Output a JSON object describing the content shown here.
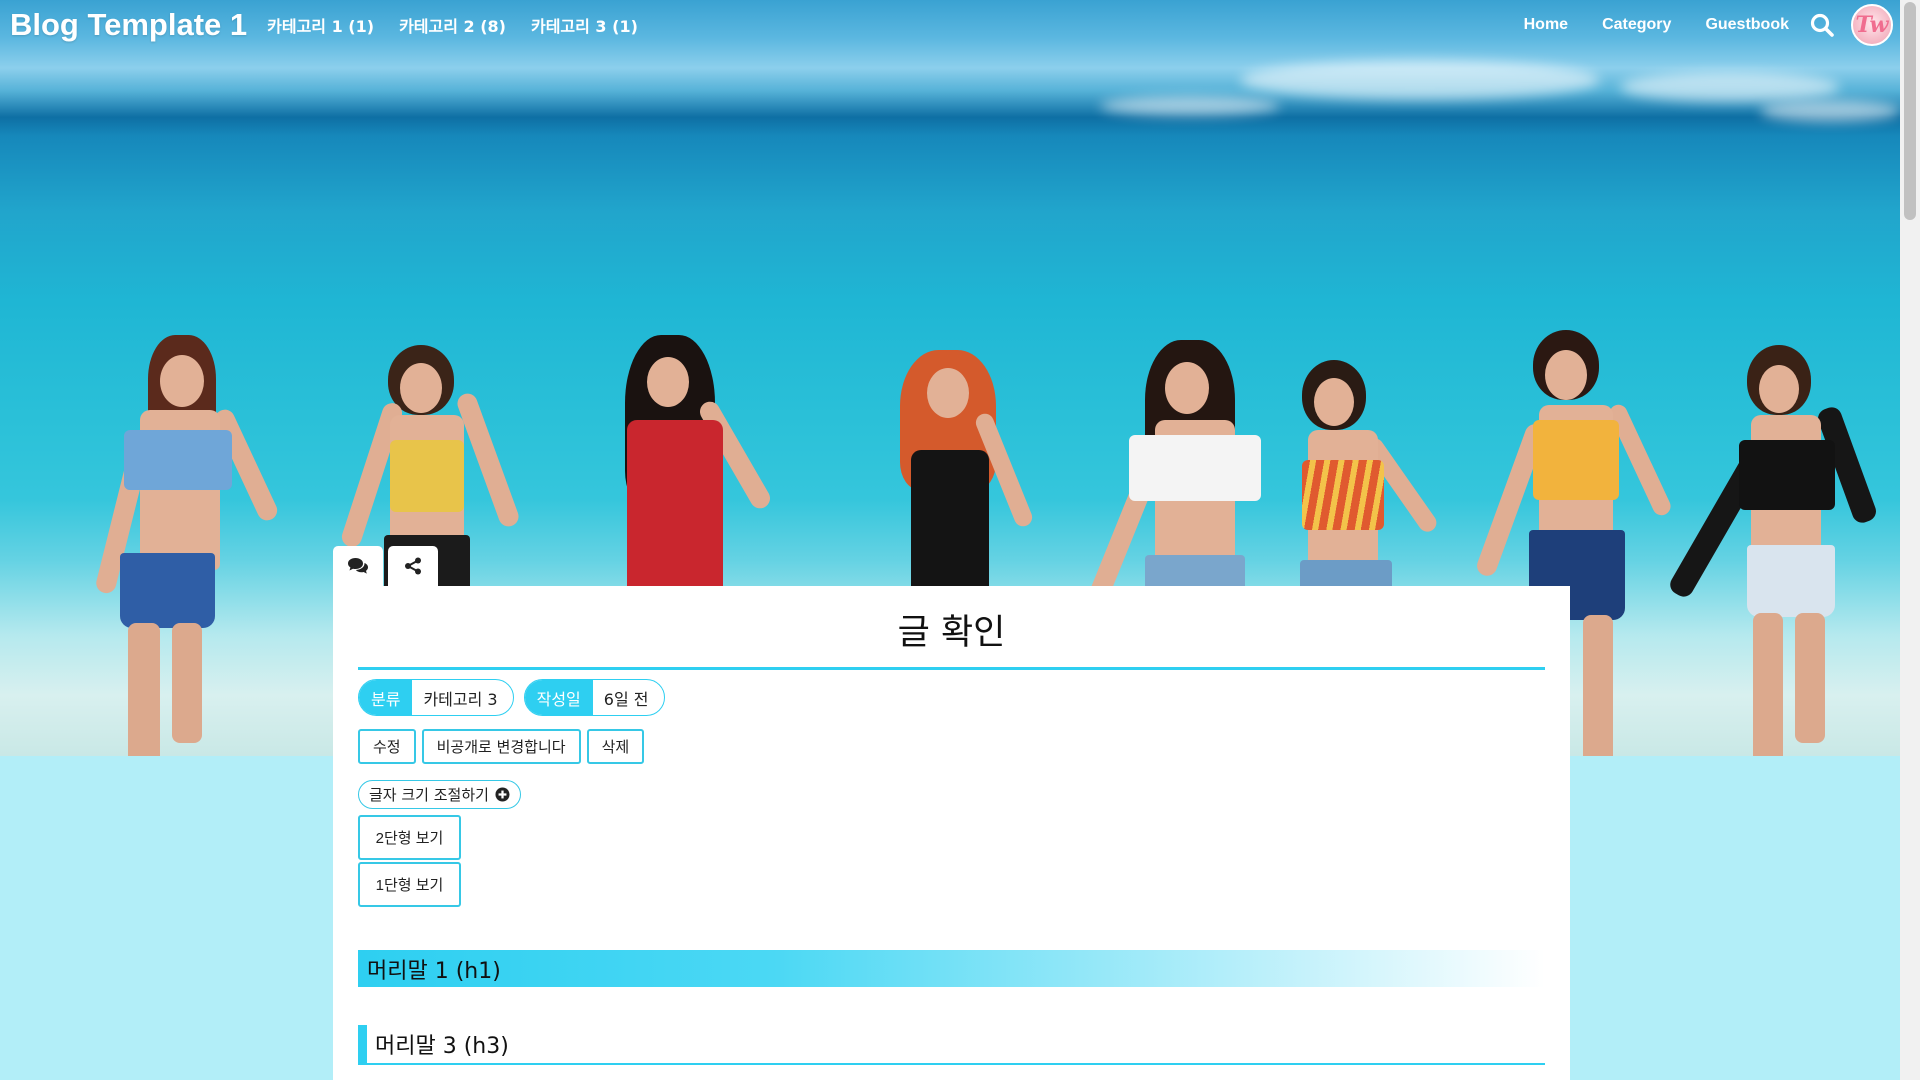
{
  "brand": {
    "title": "Blog Template 1"
  },
  "categories": [
    {
      "label": "카테고리 1 (1)"
    },
    {
      "label": "카테고리 2 (8)"
    },
    {
      "label": "카테고리 3 (1)"
    }
  ],
  "nav": {
    "home": "Home",
    "category": "Category",
    "guestbook": "Guestbook",
    "search_icon": "search-icon",
    "avatar_glyph": "Tw"
  },
  "article": {
    "title": "글 확인",
    "meta": [
      {
        "key": "분류",
        "value": "카테고리 3"
      },
      {
        "key": "작성일",
        "value": "6일 전"
      }
    ],
    "actions": {
      "edit": "수정",
      "private": "비공개로 변경합니다",
      "delete": "삭제"
    },
    "font_size_label": "글자 크기 조절하기",
    "view_two_column": "2단형 보기",
    "view_one_column": "1단형 보기",
    "heading_h1": "머리말 1 (h1)",
    "heading_h3": "머리말 3 (h3)"
  },
  "tabs": {
    "comment_icon": "comments-icon",
    "share_icon": "share-icon"
  },
  "colors": {
    "accent": "#2ecff1",
    "page_bg": "#b2eef8"
  }
}
